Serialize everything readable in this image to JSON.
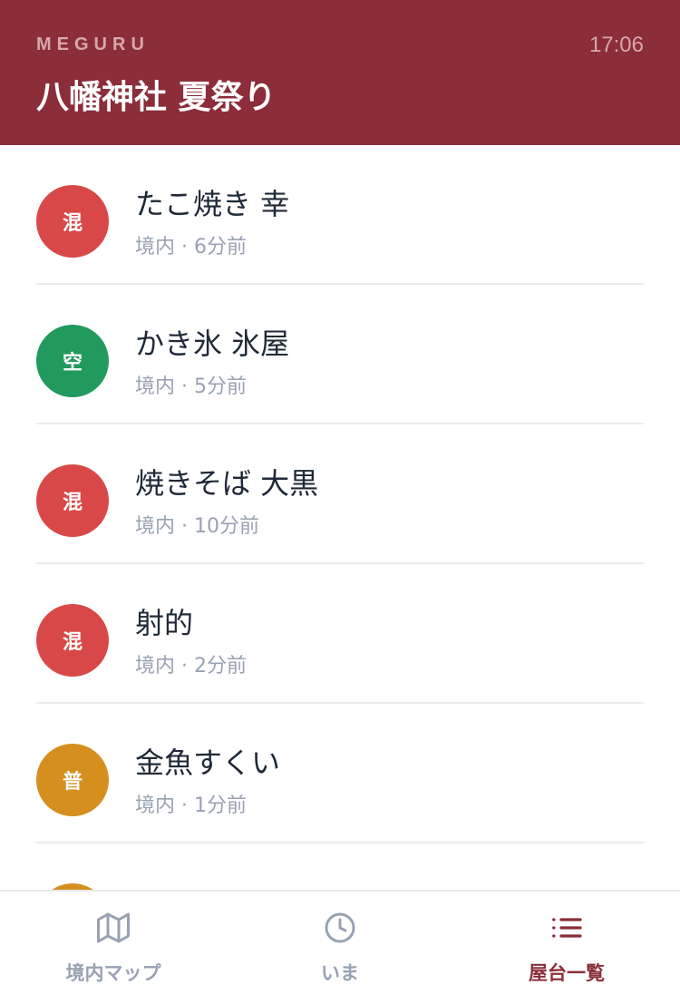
{
  "header": {
    "brand": "MEGURU",
    "time": "17:06",
    "title": "八幡神社 夏祭り"
  },
  "colors": {
    "header_bg": "#8b2e3a",
    "crowded": "#d94848",
    "empty": "#229a5e",
    "normal": "#d48f1f",
    "active_tab": "#8b2e3a",
    "inactive_tab": "#98a2b3"
  },
  "stalls": [
    {
      "badge": "混",
      "status": "crowded",
      "name": "たこ焼き 幸",
      "location": "境内",
      "separator": "·",
      "updated": "6分前"
    },
    {
      "badge": "空",
      "status": "empty",
      "name": "かき氷 氷屋",
      "location": "境内",
      "separator": "·",
      "updated": "5分前"
    },
    {
      "badge": "混",
      "status": "crowded",
      "name": "焼きそば 大黒",
      "location": "境内",
      "separator": "·",
      "updated": "10分前"
    },
    {
      "badge": "混",
      "status": "crowded",
      "name": "射的",
      "location": "境内",
      "separator": "·",
      "updated": "2分前"
    },
    {
      "badge": "普",
      "status": "normal",
      "name": "金魚すくい",
      "location": "境内",
      "separator": "·",
      "updated": "1分前"
    }
  ],
  "tabs": [
    {
      "label": "境内マップ",
      "icon": "map-icon",
      "active": false
    },
    {
      "label": "いま",
      "icon": "clock-icon",
      "active": false
    },
    {
      "label": "屋台一覧",
      "icon": "list-icon",
      "active": true
    }
  ]
}
